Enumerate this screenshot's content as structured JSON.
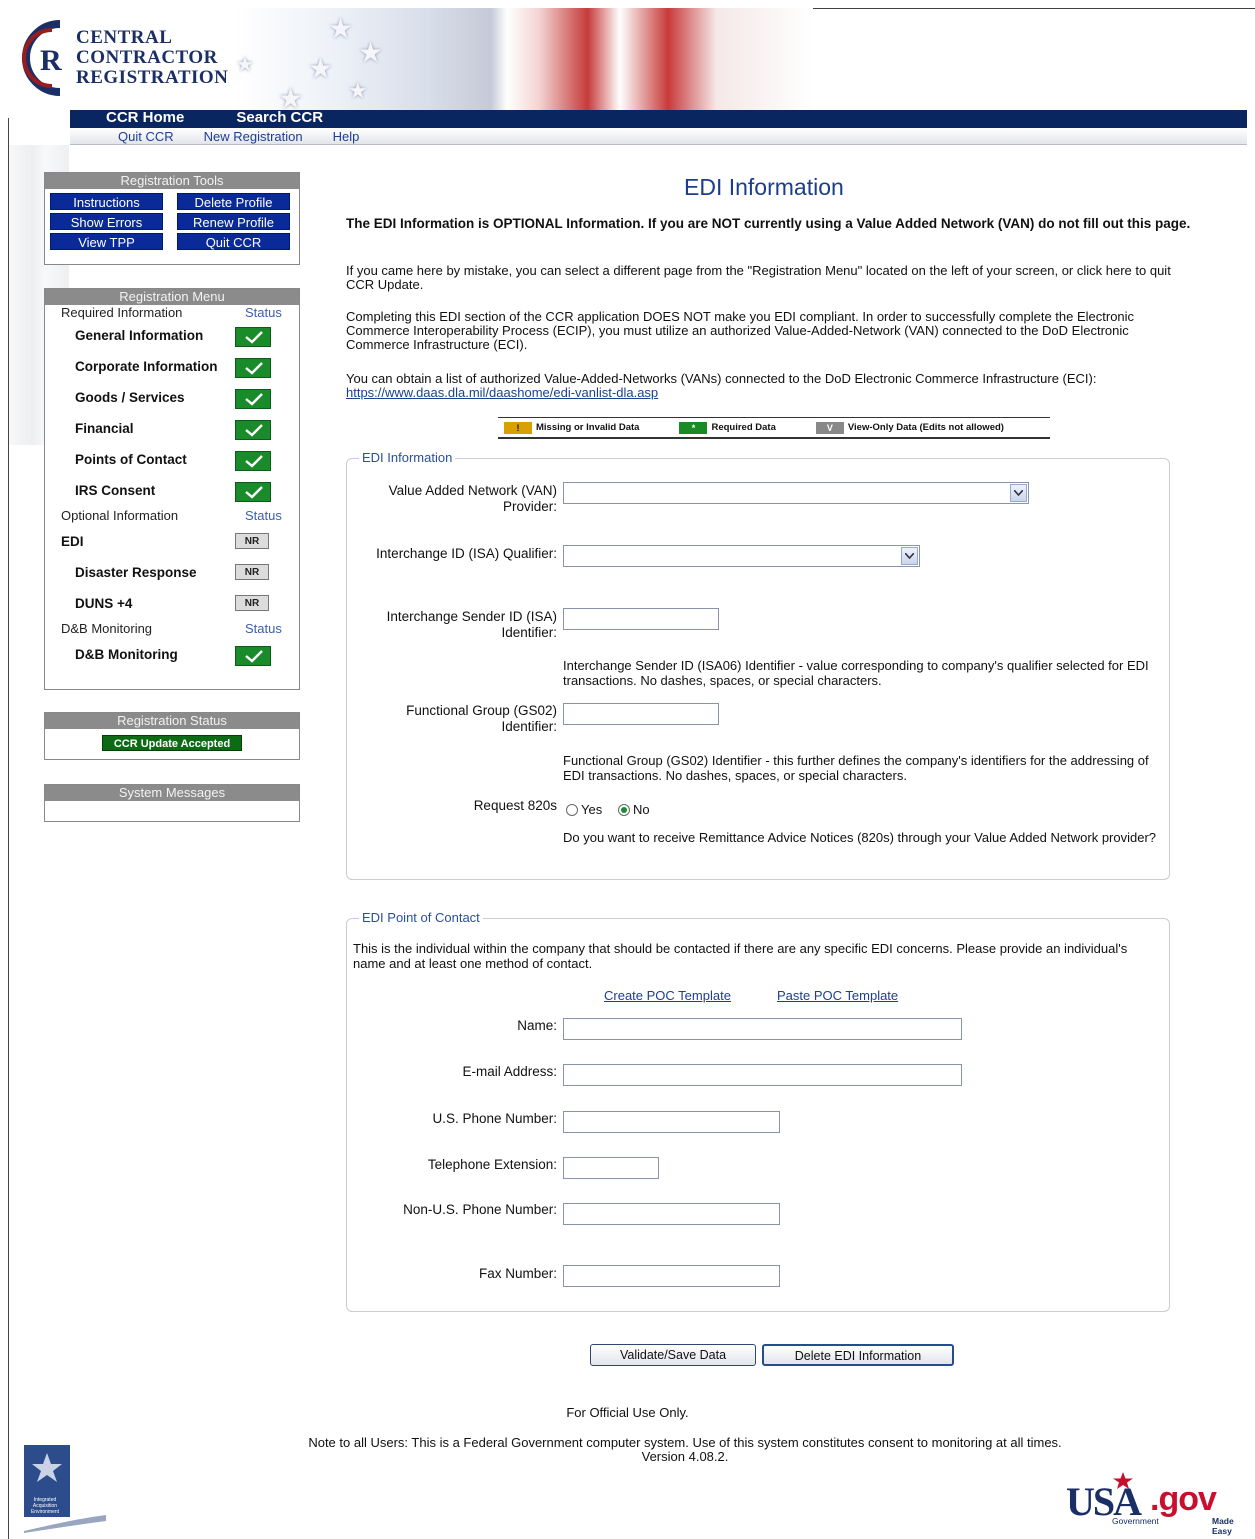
{
  "header": {
    "logo_lines": [
      "CENTRAL",
      "CONTRACTOR",
      "REGISTRATION"
    ],
    "nav_main": [
      "CCR Home",
      "Search CCR"
    ],
    "nav_sub": [
      "Quit CCR",
      "New Registration",
      "Help"
    ]
  },
  "tools": {
    "title": "Registration Tools",
    "buttons": [
      "Instructions",
      "Delete Profile",
      "Show Errors",
      "Renew Profile",
      "View TPP",
      "Quit CCR"
    ]
  },
  "menu": {
    "title": "Registration Menu",
    "required_label": "Required Information",
    "status_label": "Status",
    "required_items": [
      "General Information",
      "Corporate Information",
      "Goods / Services",
      "Financial",
      "Points of Contact",
      "IRS Consent"
    ],
    "optional_label": "Optional Information",
    "optional_items": [
      "EDI",
      "Disaster Response",
      "DUNS +4"
    ],
    "nr_text": "NR",
    "dnb_label": "D&B Monitoring",
    "dnb_items": [
      "D&B Monitoring"
    ]
  },
  "reg_status": {
    "title": "Registration Status",
    "badge": "CCR Update Accepted"
  },
  "system_messages": {
    "title": "System Messages"
  },
  "main": {
    "title": "EDI Information",
    "intro_bold": "The EDI Information is OPTIONAL Information. If you are NOT currently using a Value Added Network (VAN) do not fill out this page.",
    "intro_p1": "If you came here by mistake, you can select a different page from the \"Registration Menu\" located on the left of your screen, or click here to quit CCR Update.",
    "intro_p2": "Completing this EDI section of the CCR application DOES NOT make you EDI compliant. In order to successfully complete the Electronic Commerce Interoperability Process (ECIP), you must utilize an authorized Value-Added-Network (VAN) connected to the DoD Electronic Commerce Infrastructure (ECI).",
    "intro_p3": "You can obtain a list of authorized Value-Added-Networks (VANs) connected to the DoD Electronic Commerce Infrastructure (ECI):",
    "van_link": "https://www.daas.dla.mil/daashome/edi-vanlist-dla.asp",
    "legend": {
      "missing": "Missing or Invalid Data",
      "required": "Required Data",
      "viewonly": "View-Only Data (Edits not allowed)",
      "missing_mark": "!",
      "required_mark": "*",
      "viewonly_mark": "V"
    }
  },
  "edi": {
    "legend": "EDI Information",
    "van_label": "Value Added Network (VAN) Provider:",
    "isa_qual_label": "Interchange ID (ISA) Qualifier:",
    "isa_id_label": "Interchange Sender ID (ISA) Identifier:",
    "isa_help": "Interchange Sender ID (ISA06) Identifier - value corresponding to company's qualifier selected for EDI transactions. No dashes, spaces, or special characters.",
    "gs02_label": "Functional Group (GS02) Identifier:",
    "gs02_help": "Functional Group (GS02) Identifier - this further defines the company's identifiers for the addressing of EDI transactions. No dashes, spaces, or special characters.",
    "r820_label": "Request 820s",
    "r820_yes": "Yes",
    "r820_no": "No",
    "r820_selected": "No",
    "r820_help": "Do you want to receive Remittance Advice Notices (820s) through your Value Added Network provider?"
  },
  "poc": {
    "legend": "EDI Point of Contact",
    "intro": "This is the individual within the company that should be contacted if there are any specific EDI concerns. Please provide an individual's name and at least one method of contact.",
    "create_link": "Create POC Template",
    "paste_link": "Paste POC Template",
    "name_label": "Name:",
    "email_label": "E-mail Address:",
    "usphone_label": "U.S. Phone Number:",
    "ext_label": "Telephone Extension:",
    "nonus_label": "Non-U.S. Phone Number:",
    "fax_label": "Fax Number:"
  },
  "actions": {
    "save": "Validate/Save Data",
    "delete": "Delete EDI Information"
  },
  "footer": {
    "official": "For Official Use Only.",
    "note": "Note to all Users: This is a Federal Government computer system. Use of this system constitutes consent to monitoring at all times.",
    "version": "Version 4.08.2.",
    "iae_lines": [
      "Integrated",
      "Acquisition",
      "Environment"
    ],
    "usa_main": "USA",
    "usa_gov": ".gov",
    "usa_tag1": "Government",
    "usa_tag2": "Made Easy"
  },
  "colors": {
    "navy": "#0a2661",
    "link": "#1c3e93",
    "check_green": "#1a8b2a",
    "panel_gray": "#8b8b8b"
  }
}
